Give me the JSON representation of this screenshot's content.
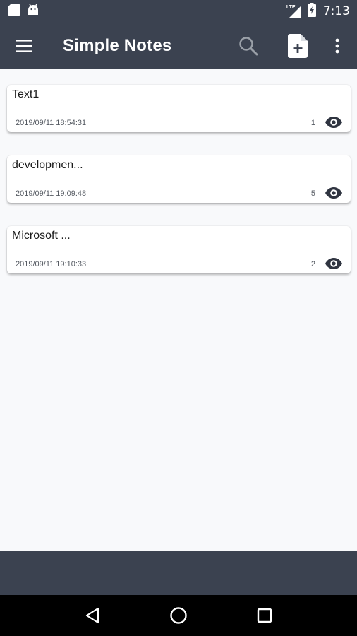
{
  "status_bar": {
    "time": "7:13",
    "network_label": "LTE",
    "icons": [
      "sd-card-icon",
      "android-icon",
      "lte-signal-icon",
      "battery-charging-icon"
    ]
  },
  "app_bar": {
    "title": "Simple Notes",
    "icons": [
      "menu-icon",
      "search-icon",
      "add-note-icon",
      "more-vert-icon"
    ]
  },
  "notes": [
    {
      "title": "Text1",
      "date": "2019/09/11 18:54:31",
      "views": "1"
    },
    {
      "title": "developmen...",
      "date": "2019/09/11 19:09:48",
      "views": "5"
    },
    {
      "title": "Microsoft ...",
      "date": "2019/09/11 19:10:33",
      "views": "2"
    }
  ],
  "nav_bar": {
    "icons": [
      "back-icon",
      "home-icon",
      "recents-icon"
    ]
  },
  "colors": {
    "bar": "#3b4250",
    "background": "#f8f9fb",
    "card": "#ffffff",
    "text_primary": "#1a1a1a",
    "text_secondary": "#555a62",
    "nav": "#000000"
  }
}
